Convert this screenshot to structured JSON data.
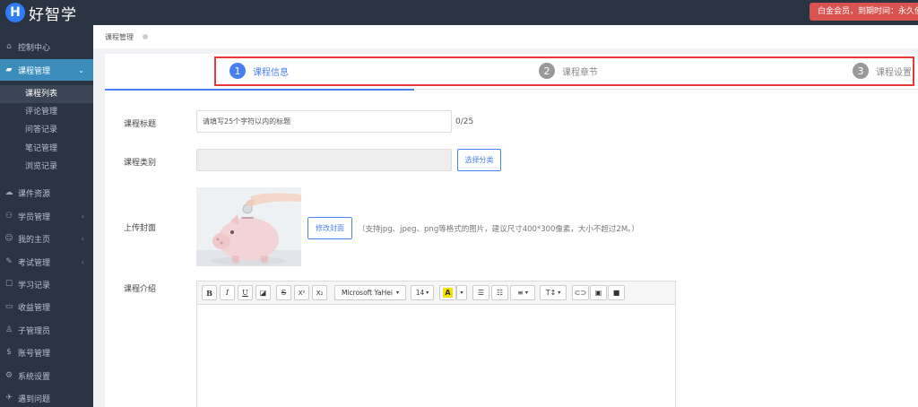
{
  "header": {
    "logo_letter": "H",
    "logo_text": "好智学",
    "member_badge": "白金会员，到期时间：永久使用"
  },
  "sidebar": {
    "items": [
      {
        "label": "控制中心",
        "icon": "home-icon"
      },
      {
        "label": "课程管理",
        "icon": "book-icon",
        "active": true,
        "chevron": "⌄"
      },
      {
        "label": "课件资源",
        "icon": "cloud-icon"
      },
      {
        "label": "学员管理",
        "icon": "users-icon",
        "chevron": "‹"
      },
      {
        "label": "我的主页",
        "icon": "user-icon",
        "chevron": "‹"
      },
      {
        "label": "考试管理",
        "icon": "exam-icon",
        "chevron": "‹"
      },
      {
        "label": "学习记录",
        "icon": "record-icon"
      },
      {
        "label": "收益管理",
        "icon": "wallet-icon"
      },
      {
        "label": "子管理员",
        "icon": "admin-icon"
      },
      {
        "label": "账号管理",
        "icon": "dollar-icon"
      },
      {
        "label": "系统设置",
        "icon": "gear-icon"
      },
      {
        "label": "遇到问题",
        "icon": "help-icon"
      }
    ],
    "sub_items": [
      {
        "label": "课程列表",
        "active": true
      },
      {
        "label": "评论管理"
      },
      {
        "label": "问答记录"
      },
      {
        "label": "笔记管理"
      },
      {
        "label": "浏览记录"
      }
    ]
  },
  "breadcrumb": {
    "label": "课程管理"
  },
  "steps": [
    {
      "num": "1",
      "label": "课程信息",
      "active": true
    },
    {
      "num": "2",
      "label": "课程章节"
    },
    {
      "num": "3",
      "label": "课程设置"
    }
  ],
  "form": {
    "title_label": "课程标题",
    "title_placeholder": "请填写25个字符以内的标题",
    "title_counter": "0/25",
    "category_label": "课程类别",
    "category_button": "选择分类",
    "cover_label": "上传封面",
    "cover_button": "修改封面",
    "cover_hint": "（支持jpg、jpeg、png等格式的图片，建议尺寸400*300像素，大小不超过2M。）",
    "intro_label": "课程介绍"
  },
  "editor": {
    "bold": "B",
    "italic": "I",
    "underline": "U",
    "strike": "S",
    "superscript": "X²",
    "subscript": "X₂",
    "font_family": "Microsoft YaHei",
    "font_size": "14",
    "font_color_letter": "A",
    "line_height": "T↕"
  },
  "colors": {
    "sidebar_bg": "#2b3442",
    "accent": "#4a7ff0",
    "active_menu": "#3c8dbc",
    "badge_red": "#d9534f",
    "outline_red": "#e53935"
  }
}
